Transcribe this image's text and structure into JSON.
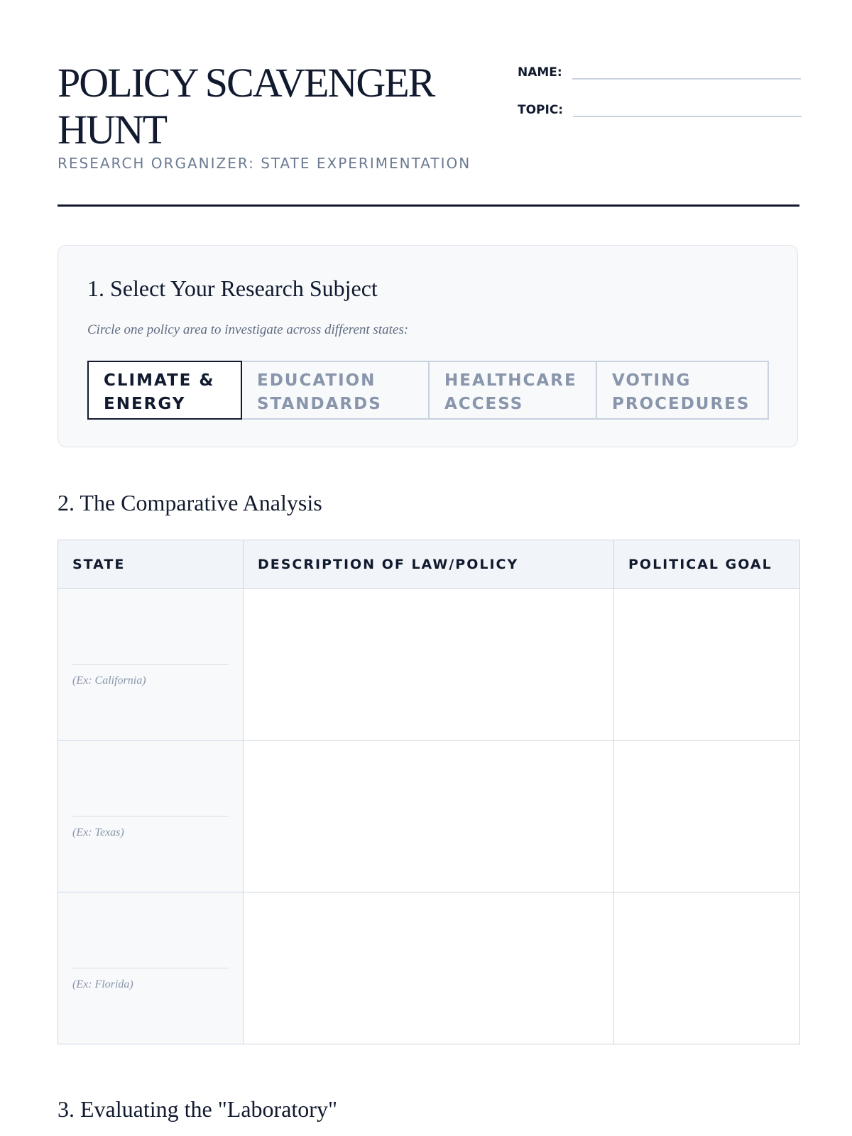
{
  "header": {
    "title": "POLICY SCAVENGER HUNT",
    "subtitle": "RESEARCH ORGANIZER: STATE EXPERIMENTATION",
    "name_label": "NAME:",
    "topic_label": "TOPIC:"
  },
  "section1": {
    "heading": "1. Select Your Research Subject",
    "instructions": "Circle one policy area to investigate across different states:",
    "options": [
      {
        "label": "CLIMATE &\nENERGY",
        "selected": true
      },
      {
        "label": "EDUCATION\nSTANDARDS",
        "selected": false
      },
      {
        "label": "HEALTHCARE\nACCESS",
        "selected": false
      },
      {
        "label": "VOTING\nPROCEDURES",
        "selected": false
      }
    ]
  },
  "section2": {
    "heading": "2. The Comparative Analysis",
    "columns": [
      "STATE",
      "DESCRIPTION OF LAW/POLICY",
      "POLITICAL GOAL"
    ],
    "rows": [
      {
        "state_example": "(Ex: California)"
      },
      {
        "state_example": "(Ex: Texas)"
      },
      {
        "state_example": "(Ex: Florida)"
      }
    ]
  },
  "section3": {
    "heading": "3. Evaluating the \"Laboratory\""
  },
  "colors": {
    "ink": "#111a2e",
    "muted": "#6b7a92",
    "border": "#cdd6e1",
    "panel": "#f7f9fb"
  }
}
